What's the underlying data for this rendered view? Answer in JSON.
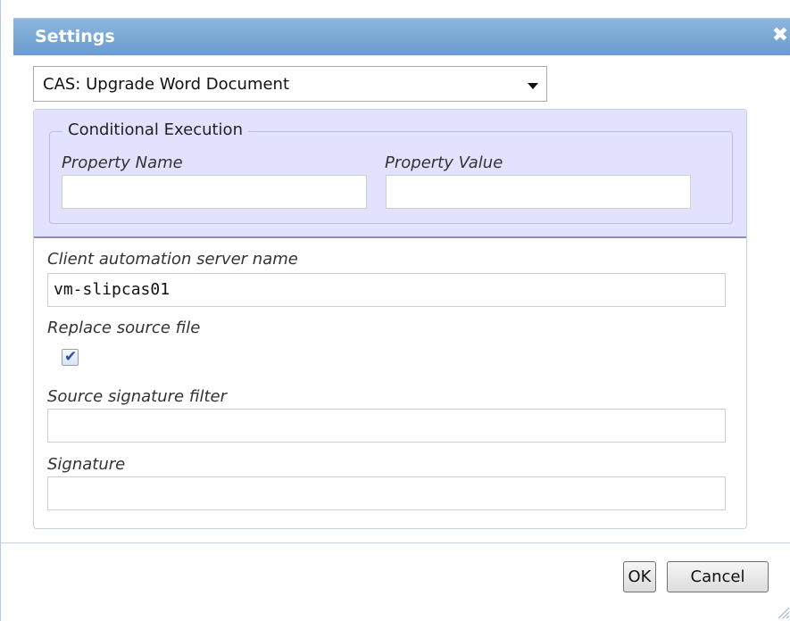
{
  "window": {
    "title": "Settings",
    "close_glyph": "✖"
  },
  "task_select": {
    "value": "CAS: Upgrade Word Document"
  },
  "conditional_execution": {
    "legend": "Conditional Execution",
    "property_name_label": "Property Name",
    "property_name_value": "",
    "property_value_label": "Property Value",
    "property_value_value": ""
  },
  "fields": {
    "server_name_label": "Client automation server name",
    "server_name_value": "vm-slipcas01",
    "replace_source_label": "Replace source file",
    "replace_source_checked": true,
    "replace_source_mark": "✔",
    "source_filter_label": "Source signature filter",
    "source_filter_value": "",
    "signature_label": "Signature",
    "signature_value": ""
  },
  "buttons": {
    "ok": "OK",
    "cancel": "Cancel"
  },
  "colors": {
    "titlebar": "#7aa9d6",
    "conditional_bg": "#e2e2ff",
    "checkbox_mark": "#2c50a6"
  },
  "icons": {
    "close": "close-icon",
    "dropdown": "chevron-down-icon",
    "resize": "resize-grip-icon"
  }
}
